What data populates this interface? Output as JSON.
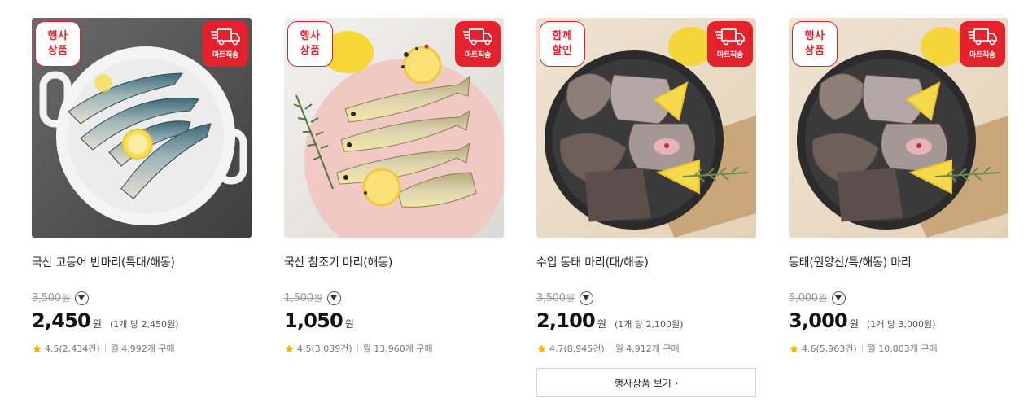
{
  "products": [
    {
      "badge": [
        "행사",
        "상품"
      ],
      "mart_badge": "마트직송",
      "title": "국산 고등어 반마리(특대/해동)",
      "original_price": "3,500",
      "original_unit": "원",
      "sale_price": "2,450",
      "sale_unit": "원",
      "per_unit": "(1개 당 2,450원)",
      "rating": "4.5(2,434건)",
      "monthly": "월 4,992개 구매"
    },
    {
      "badge": [
        "행사",
        "상품"
      ],
      "mart_badge": "마트직송",
      "title": "국산 참조기 마리(해동)",
      "original_price": "1,500",
      "original_unit": "원",
      "sale_price": "1,050",
      "sale_unit": "원",
      "per_unit": "",
      "rating": "4.5(3,039건)",
      "monthly": "월 13,960개 구매"
    },
    {
      "badge": [
        "함께",
        "할인"
      ],
      "mart_badge": "마트직송",
      "title": "수입 동태 마리(대/해동)",
      "original_price": "3,500",
      "original_unit": "원",
      "sale_price": "2,100",
      "sale_unit": "원",
      "per_unit": "(1개 당 2,100원)",
      "rating": "4.7(8,945건)",
      "monthly": "월 4,912개 구매"
    },
    {
      "badge": [
        "행사",
        "상품"
      ],
      "mart_badge": "마트직송",
      "title": "동태(원양산/특/해동) 마리",
      "original_price": "5,000",
      "original_unit": "원",
      "sale_price": "3,000",
      "sale_unit": "원",
      "per_unit": "(1개 당 3,000원)",
      "rating": "4.6(5,963건)",
      "monthly": "월 10,803개 구매"
    }
  ],
  "event_link": {
    "label": "행사상품 보기",
    "chevron": "›"
  },
  "icons": {
    "truck": "truck-icon",
    "star": "star-icon",
    "chevron": "chevron-down-icon"
  },
  "colors": {
    "accent_red": "#e4222e",
    "star": "#f5b400",
    "strike": "#999999"
  }
}
